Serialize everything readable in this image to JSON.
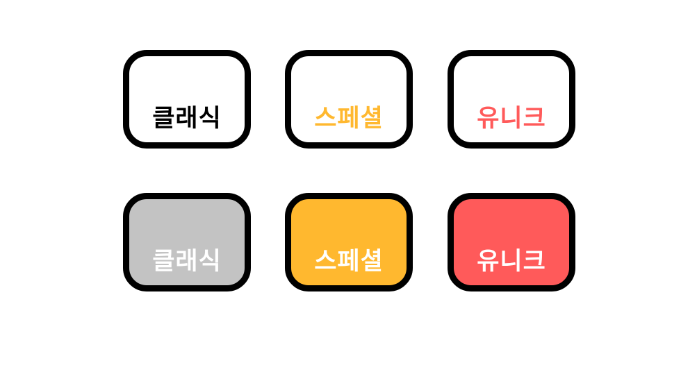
{
  "colors": {
    "border": "#000000",
    "classic_text": "#000000",
    "special": "#FFB82F",
    "unique": "#FF5A5A",
    "classic_fill": "#C3C3C3",
    "outline_bg": "#FFFFFF",
    "filled_text": "#FFFFFF"
  },
  "outline_tiles": [
    {
      "label": "클래식",
      "style": "outline",
      "text_color": "#000000",
      "background": "#FFFFFF"
    },
    {
      "label": "스페셜",
      "style": "outline",
      "text_color": "#FFB82F",
      "background": "#FFFFFF"
    },
    {
      "label": "유니크",
      "style": "outline",
      "text_color": "#FF5A5A",
      "background": "#FFFFFF"
    }
  ],
  "filled_tiles": [
    {
      "label": "클래식",
      "style": "filled",
      "text_color": "#FFFFFF",
      "background": "#C3C3C3"
    },
    {
      "label": "스페셜",
      "style": "filled",
      "text_color": "#FFFFFF",
      "background": "#FFB82F"
    },
    {
      "label": "유니크",
      "style": "filled",
      "text_color": "#FFFFFF",
      "background": "#FF5A5A"
    }
  ]
}
